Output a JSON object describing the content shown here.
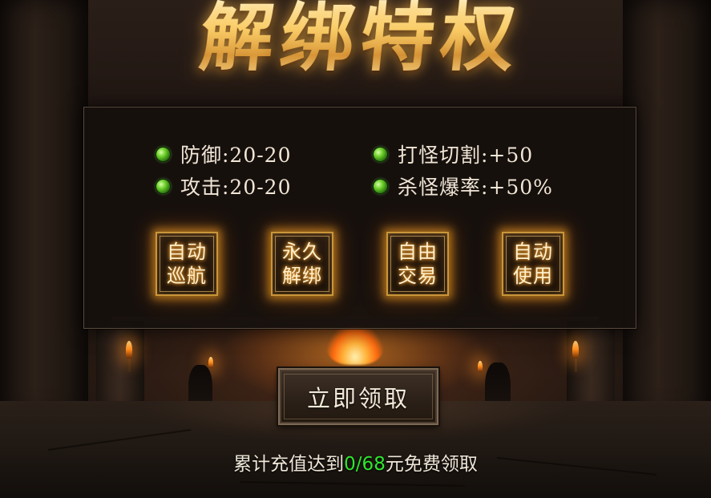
{
  "title": "解绑特权",
  "stats": [
    {
      "label": "防御:20-20"
    },
    {
      "label": "攻击:20-20"
    },
    {
      "label": "打怪切割:+50"
    },
    {
      "label": "杀怪爆率:+50%"
    }
  ],
  "features": [
    {
      "line1": "自动",
      "line2": "巡航"
    },
    {
      "line1": "永久",
      "line2": "解绑"
    },
    {
      "line1": "自由",
      "line2": "交易"
    },
    {
      "line1": "自动",
      "line2": "使用"
    }
  ],
  "claim_button": {
    "label": "立即领取"
  },
  "progress": {
    "prefix": "累计充值达到",
    "current": "0/68",
    "suffix": "元免费领取"
  },
  "colors": {
    "title_gold": "#f7cf6e",
    "badge_glow": "#ffaa28",
    "gem_green": "#6ccf2a",
    "progress_green": "#2ee62e"
  }
}
